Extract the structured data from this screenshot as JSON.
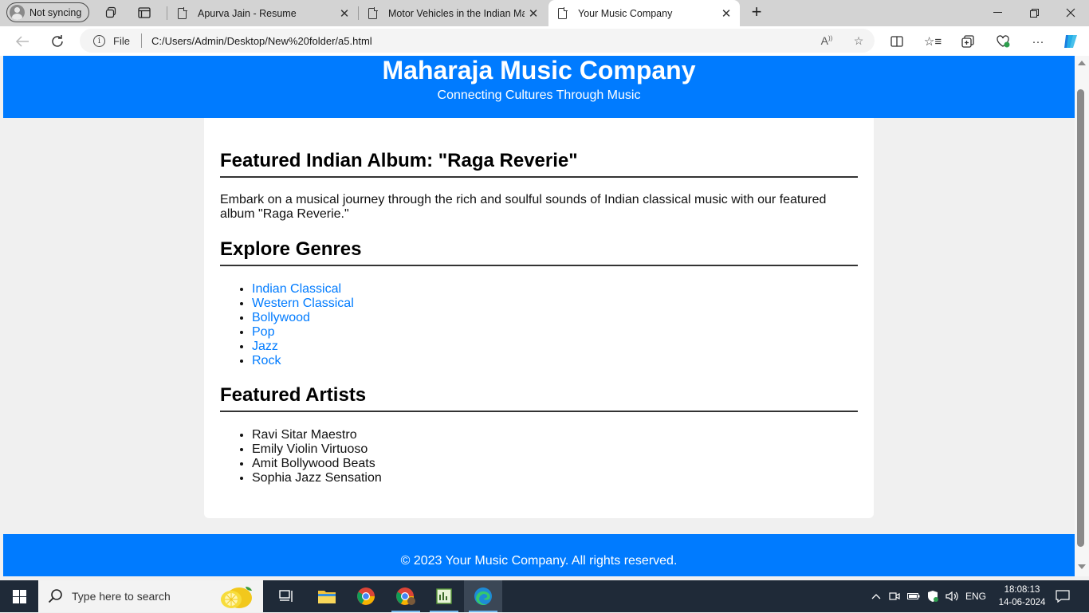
{
  "browser": {
    "profile_label": "Not syncing",
    "tabs": [
      {
        "title": "Apurva Jain - Resume",
        "active": false
      },
      {
        "title": "Motor Vehicles in the Indian Mar",
        "active": false
      },
      {
        "title": "Your Music Company",
        "active": true
      }
    ],
    "address": {
      "scheme_label": "File",
      "url": "C:/Users/Admin/Desktop/New%20folder/a5.html"
    }
  },
  "page": {
    "header": {
      "title": "Maharaja Music Company",
      "subtitle": "Connecting Cultures Through Music"
    },
    "featured": {
      "heading": "Featured Indian Album: \"Raga Reverie\"",
      "description": "Embark on a musical journey through the rich and soulful sounds of Indian classical music with our featured album \"Raga Reverie.\""
    },
    "genres": {
      "heading": "Explore Genres",
      "items": [
        "Indian Classical",
        "Western Classical",
        "Bollywood",
        "Pop",
        "Jazz",
        "Rock"
      ]
    },
    "artists": {
      "heading": "Featured Artists",
      "items": [
        "Ravi Sitar Maestro",
        "Emily Violin Virtuoso",
        "Amit Bollywood Beats",
        "Sophia Jazz Sensation"
      ]
    },
    "footer": "© 2023 Your Music Company. All rights reserved."
  },
  "taskbar": {
    "search_placeholder": "Type here to search",
    "language": "ENG",
    "time": "18:08:13",
    "date": "14-06-2024"
  },
  "colors": {
    "brand_blue": "#007bff",
    "link": "#007bff",
    "taskbar": "#1f2a38"
  }
}
